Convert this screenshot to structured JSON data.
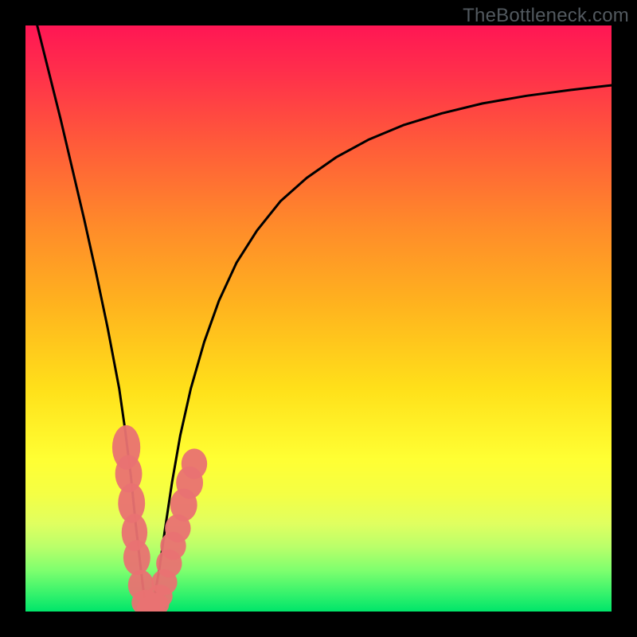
{
  "watermark": "TheBottleneck.com",
  "colors": {
    "frame": "#000000",
    "curve": "#000000",
    "marker_fill": "#e97272",
    "marker_stroke": "#c94f4f"
  },
  "chart_data": {
    "type": "line",
    "title": "",
    "xlabel": "",
    "ylabel": "",
    "xlim": [
      0,
      100
    ],
    "ylim": [
      0,
      100
    ],
    "curve": {
      "x": [
        2,
        4,
        6,
        8,
        10,
        12,
        14,
        16,
        17,
        18,
        18.8,
        19.6,
        20.2,
        20.8,
        21.4,
        22,
        22.8,
        23.8,
        25,
        26.4,
        28.2,
        30.5,
        33,
        36,
        39.5,
        43.5,
        48,
        53,
        58.5,
        64.5,
        71,
        78,
        85.5,
        93,
        100
      ],
      "y": [
        100,
        92,
        84,
        75.5,
        67,
        58,
        48.5,
        38,
        31,
        23,
        15,
        8,
        3,
        0.5,
        0.5,
        2.5,
        7,
        14,
        22,
        30,
        38,
        46,
        53,
        59.5,
        65,
        70,
        74,
        77.5,
        80.5,
        83,
        85,
        86.7,
        88,
        89,
        89.8
      ]
    },
    "markers": {
      "description": "clustered bottleneck sample points near the curve minimum",
      "points": [
        {
          "x": 17.2,
          "y": 28,
          "rx": 2.4,
          "ry": 3.8
        },
        {
          "x": 17.6,
          "y": 23.5,
          "rx": 2.3,
          "ry": 3.2
        },
        {
          "x": 18.1,
          "y": 18.5,
          "rx": 2.3,
          "ry": 3.4
        },
        {
          "x": 18.6,
          "y": 13.5,
          "rx": 2.2,
          "ry": 3.2
        },
        {
          "x": 19.0,
          "y": 9.2,
          "rx": 2.3,
          "ry": 3.0
        },
        {
          "x": 19.7,
          "y": 4.5,
          "rx": 2.2,
          "ry": 2.6
        },
        {
          "x": 20.5,
          "y": 1.5,
          "rx": 2.4,
          "ry": 2.2
        },
        {
          "x": 21.4,
          "y": 0.6,
          "rx": 2.4,
          "ry": 2.0
        },
        {
          "x": 22.2,
          "y": 1.2,
          "rx": 2.3,
          "ry": 2.0
        },
        {
          "x": 22.9,
          "y": 2.6,
          "rx": 2.2,
          "ry": 2.0
        },
        {
          "x": 23.7,
          "y": 5.0,
          "rx": 2.2,
          "ry": 2.2
        },
        {
          "x": 24.5,
          "y": 8.2,
          "rx": 2.2,
          "ry": 2.4
        },
        {
          "x": 25.2,
          "y": 11.2,
          "rx": 2.2,
          "ry": 2.4
        },
        {
          "x": 26.0,
          "y": 14.2,
          "rx": 2.2,
          "ry": 2.4
        },
        {
          "x": 27.0,
          "y": 18.2,
          "rx": 2.3,
          "ry": 2.8
        },
        {
          "x": 28.0,
          "y": 22.0,
          "rx": 2.3,
          "ry": 2.8
        },
        {
          "x": 28.8,
          "y": 25.2,
          "rx": 2.2,
          "ry": 2.6
        }
      ]
    }
  }
}
